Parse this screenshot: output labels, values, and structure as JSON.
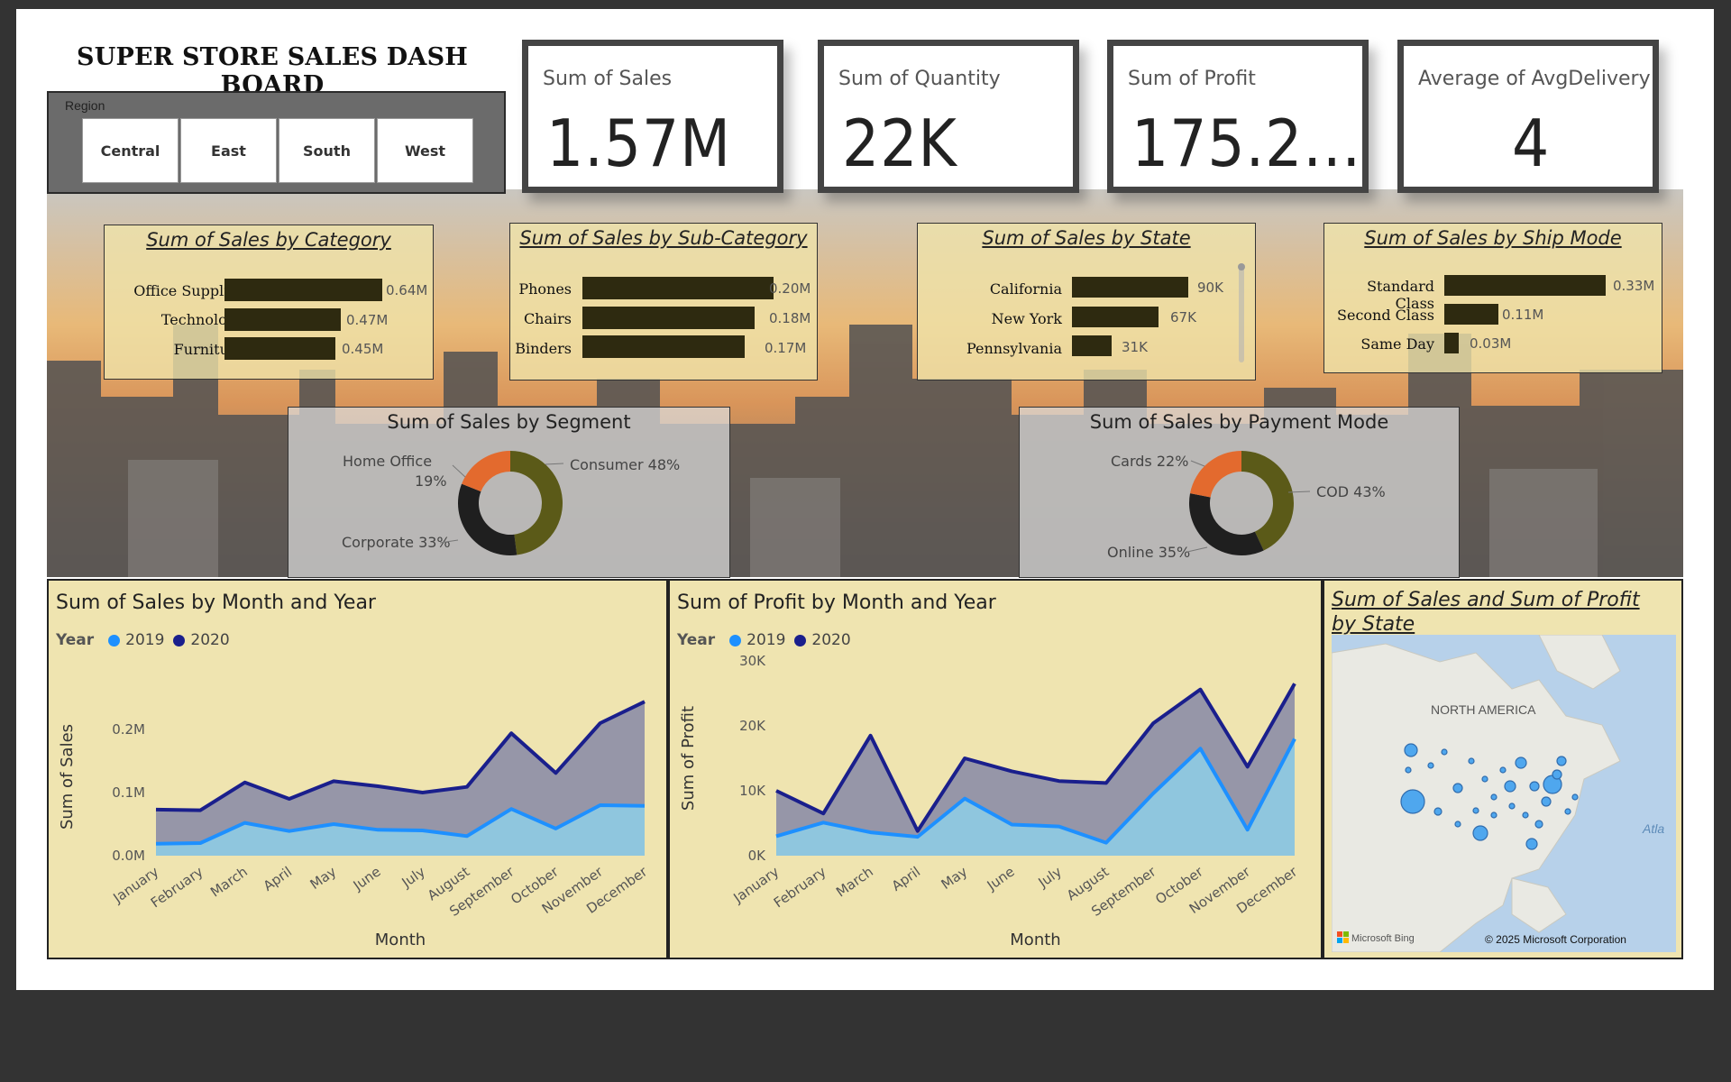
{
  "header": {
    "title": "SUPER STORE SALES DASH BOARD"
  },
  "region_slicer": {
    "label": "Region",
    "options": [
      "Central",
      "East",
      "South",
      "West"
    ]
  },
  "kpis": [
    {
      "label": "Sum of Sales",
      "value": "1.57M"
    },
    {
      "label": "Sum of Quantity",
      "value": "22K"
    },
    {
      "label": "Sum of Profit",
      "value": "175.2..."
    },
    {
      "label": "Average of AvgDelivery",
      "value": "4"
    }
  ],
  "colors": {
    "bar": "#2e2a10",
    "card_bg": "#efe4b0",
    "series_2019": "#1e90ff",
    "series_2020": "#1a1f8c",
    "area_2020": "#9696a8",
    "area_2019": "#8ec8e0",
    "donut_orange": "#e36a2e",
    "donut_olive": "#5b5a18",
    "donut_black": "#1f1f1f",
    "map_water": "#b7d1ea",
    "map_land": "#e9e9e3"
  },
  "chart_data": [
    {
      "type": "bar",
      "title": "Sum of Sales by Category",
      "categories": [
        "Office Supplies",
        "Technology",
        "Furniture"
      ],
      "values": [
        0.64,
        0.47,
        0.45
      ],
      "value_labels": [
        "0.64M",
        "0.47M",
        "0.45M"
      ]
    },
    {
      "type": "bar",
      "title": "Sum of Sales by Sub-Category",
      "categories": [
        "Phones",
        "Chairs",
        "Binders"
      ],
      "values": [
        0.2,
        0.18,
        0.17
      ],
      "value_labels": [
        "0.20M",
        "0.18M",
        "0.17M"
      ]
    },
    {
      "type": "bar",
      "title": "Sum of Sales by State",
      "categories": [
        "California",
        "New York",
        "Pennsylvania"
      ],
      "values": [
        90,
        67,
        31
      ],
      "value_labels": [
        "90K",
        "67K",
        "31K"
      ]
    },
    {
      "type": "bar",
      "title": "Sum of Sales by Ship Mode",
      "categories": [
        "Standard Class",
        "Second Class",
        "Same Day"
      ],
      "values": [
        0.33,
        0.11,
        0.03
      ],
      "value_labels": [
        "0.33M",
        "0.11M",
        "0.03M"
      ]
    },
    {
      "type": "pie",
      "title": "Sum of Sales by Segment",
      "labels": [
        "Consumer 48%",
        "Corporate 33%",
        "Home Office",
        "19%"
      ],
      "values": [
        48,
        33,
        19
      ]
    },
    {
      "type": "pie",
      "title": "Sum of Sales by Payment Mode",
      "labels": [
        "COD 43%",
        "Online 35%",
        "Cards 22%"
      ],
      "values": [
        43,
        35,
        22
      ]
    },
    {
      "type": "area",
      "title": "Sum of Sales by Month and Year",
      "xlabel": "Month",
      "ylabel": "Sum of Sales",
      "legend_title": "Year",
      "categories": [
        "January",
        "February",
        "March",
        "April",
        "May",
        "June",
        "July",
        "August",
        "September",
        "October",
        "November",
        "December"
      ],
      "yticks": [
        "0.0M",
        "0.1M",
        "0.2M"
      ],
      "ylim": [
        0,
        0.25
      ],
      "series": [
        {
          "name": "2019",
          "values": [
            0.019,
            0.02,
            0.052,
            0.039,
            0.05,
            0.041,
            0.04,
            0.031,
            0.074,
            0.043,
            0.08,
            0.079
          ]
        },
        {
          "name": "2020",
          "values": [
            0.073,
            0.072,
            0.116,
            0.09,
            0.118,
            0.11,
            0.1,
            0.109,
            0.194,
            0.131,
            0.21,
            0.244
          ]
        }
      ]
    },
    {
      "type": "area",
      "title": "Sum of Profit by Month and Year",
      "xlabel": "Month",
      "ylabel": "Sum of Profit",
      "legend_title": "Year",
      "categories": [
        "January",
        "February",
        "March",
        "April",
        "May",
        "June",
        "July",
        "August",
        "September",
        "October",
        "November",
        "December"
      ],
      "yticks": [
        "0K",
        "10K",
        "20K",
        "30K"
      ],
      "ylim": [
        0,
        30000
      ],
      "series": [
        {
          "name": "2019",
          "values": [
            3000,
            5100,
            3600,
            2900,
            8800,
            4800,
            4500,
            2000,
            9600,
            16500,
            4000,
            18000
          ]
        },
        {
          "name": "2020",
          "values": [
            10000,
            6500,
            18500,
            3800,
            15000,
            13000,
            11500,
            11200,
            20400,
            25600,
            13700,
            26500
          ]
        }
      ]
    }
  ],
  "map": {
    "title": "Sum of Sales and Sum of Profit by State",
    "region_label": "NORTH AMERICA",
    "ocean_label": "Atla",
    "provider": "Microsoft Bing",
    "copyright": "© 2025 Microsoft Corporation"
  }
}
